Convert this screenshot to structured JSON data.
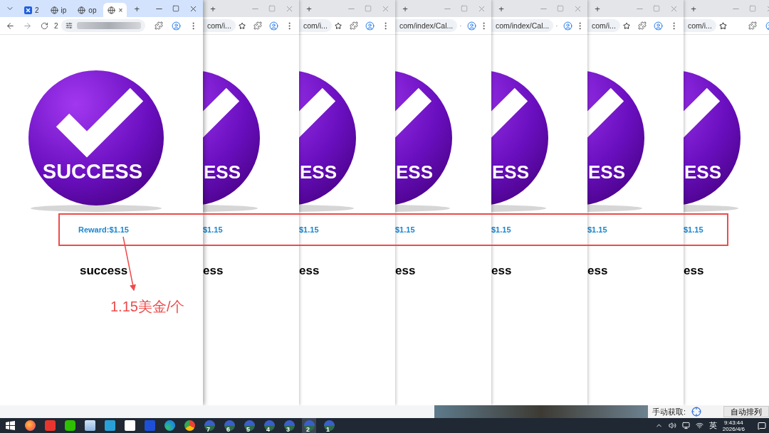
{
  "front_window": {
    "tabs": [
      {
        "kind": "app",
        "label": "2",
        "selected": false
      },
      {
        "kind": "site",
        "label": "ip",
        "selected": false
      },
      {
        "kind": "site",
        "label": "op",
        "selected": false
      },
      {
        "kind": "site",
        "close": "×",
        "selected": true
      }
    ],
    "new_tab": "+",
    "reload_badge": "2",
    "page": {
      "badge_text": "SUCCESS",
      "reward": "Reward:$1.15",
      "status": "success"
    }
  },
  "back_windows": [
    {
      "new_tab": "+",
      "address": "com/i...",
      "extensions_button": true,
      "badge_text": "ESS",
      "reward": "$1.15",
      "status": "ess"
    },
    {
      "new_tab": "+",
      "address": "com/i...",
      "extensions_button": true,
      "badge_text": "ESS",
      "reward": "$1.15",
      "status": "ess"
    },
    {
      "new_tab": "+",
      "address": "com/index/Cal...",
      "extensions_button": false,
      "badge_text": "ESS",
      "reward": "$1.15",
      "status": "ess"
    },
    {
      "new_tab": "+",
      "address": "com/index/Cal...",
      "extensions_button": false,
      "badge_text": "ESS",
      "reward": "$1.15",
      "status": "ess"
    },
    {
      "new_tab": "+",
      "address": "com/i...",
      "extensions_button": true,
      "badge_text": "ESS",
      "reward": "$1.15",
      "status": "ess"
    },
    {
      "new_tab": "+",
      "address": "com/i...",
      "extensions_button": true,
      "menu_button": false,
      "badge_text": "ESS",
      "reward": "$1.15",
      "status": "ess"
    }
  ],
  "annotation": {
    "note": "1.15美金/个"
  },
  "desktop": {
    "manual_label": "手动获取:",
    "auto_button": "自动排列"
  },
  "taskbar": {
    "apps": [
      {
        "kind": "firefox"
      },
      {
        "kind": "wps"
      },
      {
        "kind": "wechat"
      },
      {
        "kind": "windows"
      },
      {
        "kind": "textbox"
      },
      {
        "kind": "cube"
      },
      {
        "kind": "cross"
      },
      {
        "kind": "edge"
      },
      {
        "kind": "chrome"
      }
    ],
    "profiles": [
      {
        "badge": "7",
        "selected": false
      },
      {
        "badge": "6",
        "selected": false
      },
      {
        "badge": "5",
        "selected": false
      },
      {
        "badge": "4",
        "selected": false
      },
      {
        "badge": "3",
        "selected": false
      },
      {
        "badge": "2",
        "selected": true
      },
      {
        "badge": "1",
        "selected": false
      }
    ],
    "tray": {
      "ime": "英",
      "time": "9:43:44",
      "date": "2026/4/6"
    }
  }
}
